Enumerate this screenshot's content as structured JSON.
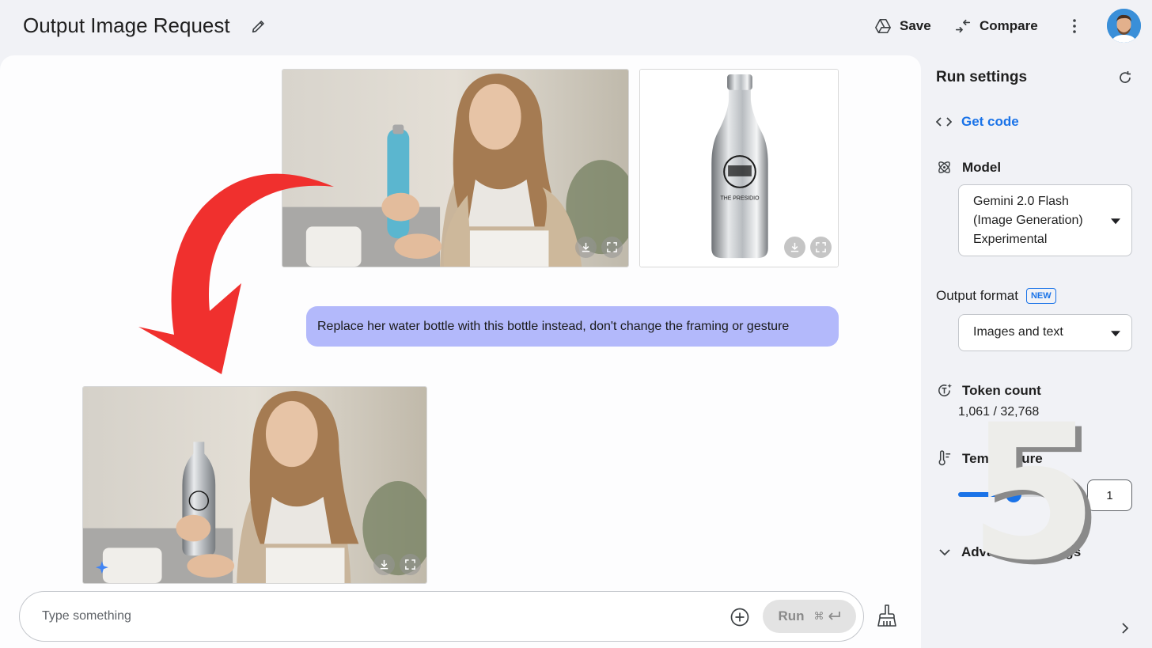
{
  "header": {
    "title": "Output Image Request",
    "save_label": "Save",
    "compare_label": "Compare"
  },
  "chat": {
    "user_message": "Replace her water bottle with this bottle instead, don't change the framing or gesture",
    "reference_bottle_text": "THE PRESIDIO",
    "input": {
      "placeholder": "Type something",
      "value": ""
    },
    "run_label": "Run",
    "run_shortcut": "⌘"
  },
  "run_settings": {
    "title": "Run settings",
    "get_code_label": "Get code",
    "model": {
      "label": "Model",
      "selected_lines": [
        "Gemini 2.0 Flash",
        "(Image Generation)",
        "Experimental"
      ]
    },
    "output_format": {
      "label": "Output format",
      "badge": "NEW",
      "selected": "Images and text"
    },
    "token_count": {
      "label": "Token count",
      "value": "1,061 / 32,768"
    },
    "temperature": {
      "label": "Temperature",
      "value": "1",
      "level": 0.5
    },
    "advanced_label": "Advanced settings"
  },
  "overlay": {
    "digit": "5",
    "arrow_color": "#f0302e"
  },
  "colors": {
    "accent": "#1a73e8",
    "user_bubble": "#b3b9fb",
    "background": "#f1f2f6"
  }
}
